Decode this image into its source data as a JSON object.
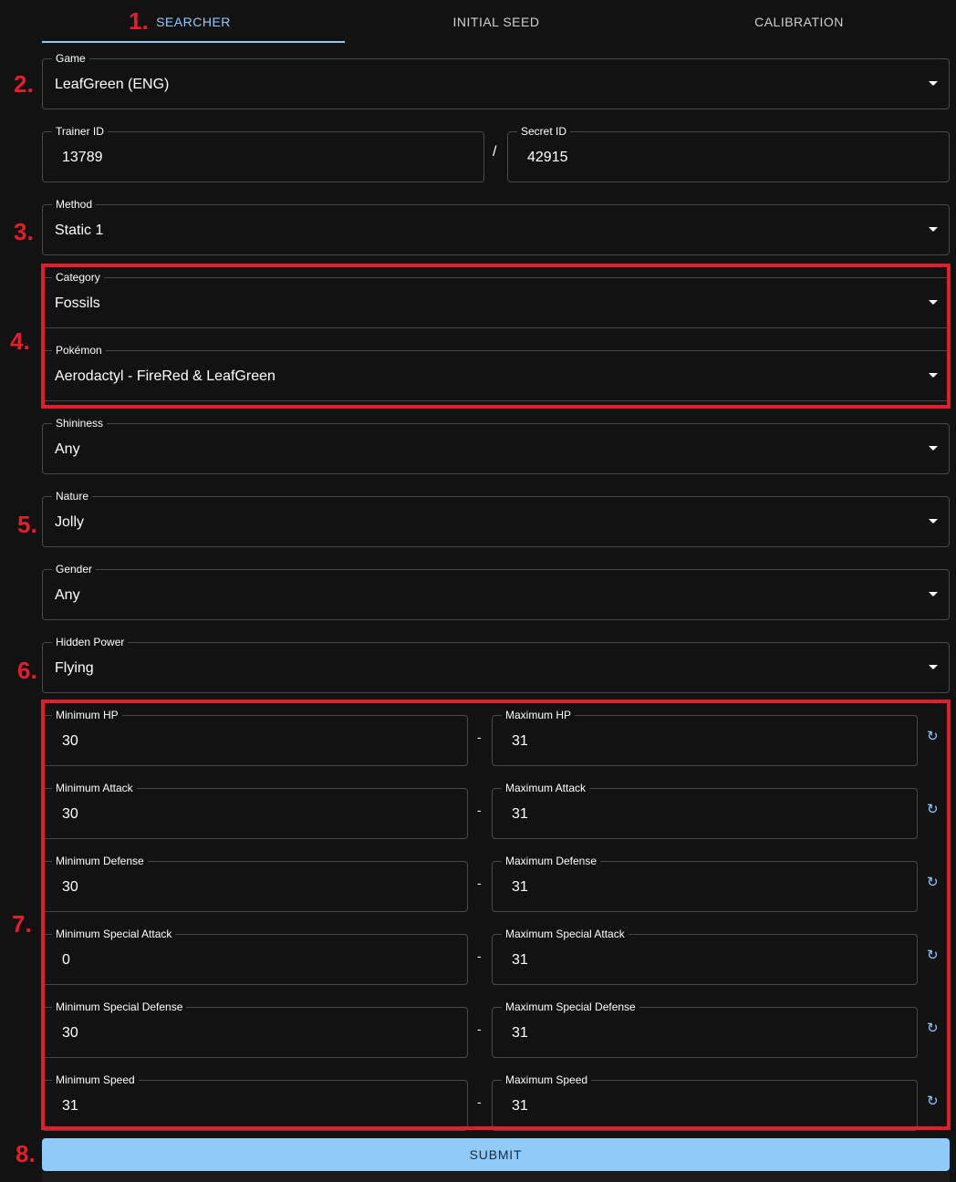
{
  "tabs": [
    {
      "label": "SEARCHER",
      "active": true
    },
    {
      "label": "INITIAL SEED",
      "active": false
    },
    {
      "label": "CALIBRATION",
      "active": false
    }
  ],
  "steps": [
    "1.",
    "2.",
    "3.",
    "4.",
    "5.",
    "6.",
    "7.",
    "8."
  ],
  "game": {
    "label": "Game",
    "value": "LeafGreen (ENG)"
  },
  "trainer_id": {
    "label": "Trainer ID",
    "value": "13789"
  },
  "id_separator": "/",
  "secret_id": {
    "label": "Secret ID",
    "value": "42915"
  },
  "method": {
    "label": "Method",
    "value": "Static 1"
  },
  "category": {
    "label": "Category",
    "value": "Fossils"
  },
  "pokemon": {
    "label": "Pokémon",
    "value": "Aerodactyl - FireRed & LeafGreen"
  },
  "shininess": {
    "label": "Shininess",
    "value": "Any"
  },
  "nature": {
    "label": "Nature",
    "value": "Jolly"
  },
  "gender": {
    "label": "Gender",
    "value": "Any"
  },
  "hidden_power": {
    "label": "Hidden Power",
    "value": "Flying"
  },
  "range_separator": "-",
  "reset_icon_glyph": "↻",
  "ivs": [
    {
      "min_label": "Minimum HP",
      "min": "30",
      "max_label": "Maximum HP",
      "max": "31"
    },
    {
      "min_label": "Minimum Attack",
      "min": "30",
      "max_label": "Maximum Attack",
      "max": "31"
    },
    {
      "min_label": "Minimum Defense",
      "min": "30",
      "max_label": "Maximum Defense",
      "max": "31"
    },
    {
      "min_label": "Minimum Special Attack",
      "min": "0",
      "max_label": "Maximum Special Attack",
      "max": "31"
    },
    {
      "min_label": "Minimum Special Defense",
      "min": "30",
      "max_label": "Maximum Special Defense",
      "max": "31"
    },
    {
      "min_label": "Minimum Speed",
      "min": "31",
      "max_label": "Maximum Speed",
      "max": "31"
    }
  ],
  "submit_label": "SUBMIT",
  "colors": {
    "accent": "#90caf9",
    "annotation_red": "#e31d2b",
    "background": "#121212"
  }
}
